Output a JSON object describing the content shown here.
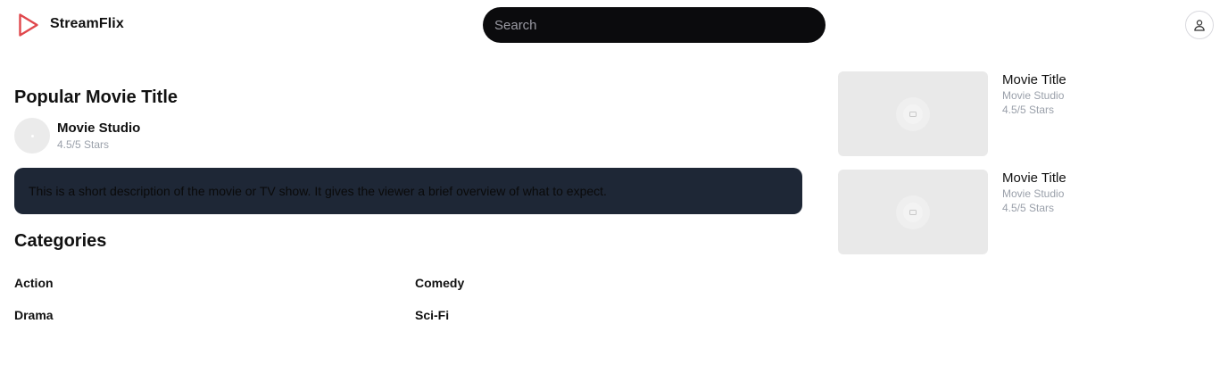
{
  "header": {
    "brand": "StreamFlix",
    "search_placeholder": "Search",
    "icons": {
      "logo": "play-triangle-icon",
      "profile": "user-icon"
    },
    "accent_color": "#e0474c"
  },
  "featured": {
    "title": "Popular Movie Title",
    "studio": "Movie Studio",
    "rating": "4.5/5 Stars",
    "description": "This is a short description of the movie or TV show. It gives the viewer a brief overview of what to expect."
  },
  "categories": {
    "title": "Categories",
    "items": [
      "Action",
      "Comedy",
      "Drama",
      "Sci-Fi"
    ]
  },
  "sidebar": {
    "items": [
      {
        "title": "Movie Title",
        "studio": "Movie Studio",
        "rating": "4.5/5 Stars"
      },
      {
        "title": "Movie Title",
        "studio": "Movie Studio",
        "rating": "4.5/5 Stars"
      }
    ]
  }
}
